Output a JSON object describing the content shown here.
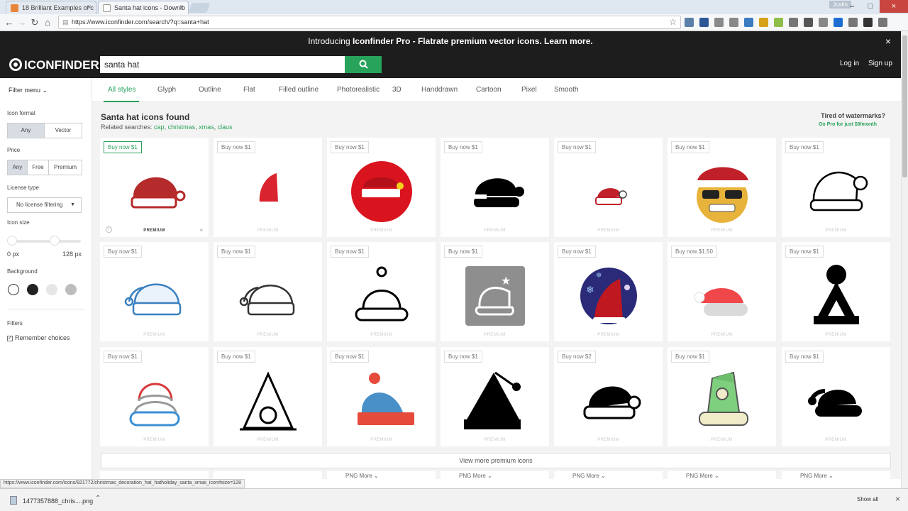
{
  "browser": {
    "tabs": [
      {
        "title": "18 Brilliant Examples of c"
      },
      {
        "title": "Santa hat icons - Downlo"
      }
    ],
    "user": "Justin",
    "url": "https://www.iconfinder.com/search/?q=santa+hat",
    "extension_colors": [
      "#5a7fa8",
      "#2b5797",
      "#8a8a8a",
      "#888",
      "#3b7bbf",
      "#d6a21b",
      "#8dbe4a",
      "#777",
      "#555",
      "#888",
      "#1e6dd3",
      "#777",
      "#333",
      "#777"
    ]
  },
  "promo": {
    "prefix": "Introducing ",
    "bold": "Iconfinder Pro",
    "rest": " - Flatrate premium vector icons. Learn more."
  },
  "header": {
    "logo": "ICONFINDER",
    "search_value": "santa hat",
    "login": "Log in",
    "signup": "Sign up"
  },
  "style_tabs": [
    "All styles",
    "Glyph",
    "Outline",
    "Flat",
    "Filled outline",
    "Photorealistic",
    "3D",
    "Handdrawn",
    "Cartoon",
    "Pixel",
    "Smooth"
  ],
  "sidebar": {
    "filter_menu": "Filter menu",
    "icon_format_label": "Icon format",
    "format_options": [
      "Any",
      "Vector"
    ],
    "price_label": "Price",
    "price_options": [
      "Any",
      "Free",
      "Premium"
    ],
    "license_label": "License type",
    "license_value": "No license filtering",
    "size_label": "Icon size",
    "size_min": "0 px",
    "size_max": "128 px",
    "background_label": "Background",
    "background_colors": [
      "#ffffff",
      "#222222",
      "#e6e6e6",
      "#bdbdbd"
    ],
    "filters_label": "Filters",
    "remember_choices": "Remember choices"
  },
  "results": {
    "title": "Santa hat icons found",
    "related_prefix": "Related searches: ",
    "related": [
      "cap",
      "christmas",
      "xmas",
      "claus"
    ],
    "tired_title": "Tired of watermarks?",
    "gopro": "Go Pro for just $9/month",
    "premium_label": "PREMIUM",
    "view_more": "View more premium icons",
    "png_label": "PNG",
    "more_label": "More",
    "cards": [
      {
        "price": "Buy now $1",
        "icon": "santa-hat-red-icon"
      },
      {
        "price": "Buy now $1",
        "icon": "santa-hat-small-red-icon"
      },
      {
        "price": "Buy now $1",
        "icon": "santa-hat-red-circle-icon"
      },
      {
        "price": "Buy now $1",
        "icon": "santa-hat-black-glyph-icon"
      },
      {
        "price": "Buy now $1",
        "icon": "santa-hat-small-lineal-icon"
      },
      {
        "price": "Buy now $1",
        "icon": "santa-emoji-sunglasses-icon"
      },
      {
        "price": "Buy now $1",
        "icon": "santa-hat-outline-icon"
      },
      {
        "price": "Buy now $1",
        "icon": "santa-hat-blue-outline-icon"
      },
      {
        "price": "Buy now $1",
        "icon": "santa-hat-gray-outline-icon"
      },
      {
        "price": "Buy now $1",
        "icon": "beanie-outline-icon"
      },
      {
        "price": "Buy now $1",
        "icon": "santa-hat-gray-square-icon"
      },
      {
        "price": "Buy now $1",
        "icon": "santa-hat-snowflake-circle-icon"
      },
      {
        "price": "Buy now $1.50",
        "icon": "santa-hat-flat-red-icon"
      },
      {
        "price": "Buy now $1",
        "icon": "elf-hat-glyph-icon"
      },
      {
        "price": "Buy now $1",
        "icon": "beanie-colored-outline-icon"
      },
      {
        "price": "Buy now $1",
        "icon": "party-hat-outline-icon"
      },
      {
        "price": "Buy now $1",
        "icon": "beanie-blue-red-icon"
      },
      {
        "price": "Buy now $1",
        "icon": "santa-hat-triangle-glyph-icon"
      },
      {
        "price": "Buy now $2",
        "icon": "santa-hat-glyph-outline-icon"
      },
      {
        "price": "Buy now $1",
        "icon": "elf-hat-green-icon"
      },
      {
        "price": "Buy now $1",
        "icon": "santa-hat-black-icon"
      }
    ]
  },
  "status_url": "https://www.iconfinder.com/icons/921772/christmas_decoration_hat_hatholiday_santa_xmas_icon#size=128",
  "downloads": {
    "file": "1477357888_chris....png",
    "show_all": "Show all"
  }
}
